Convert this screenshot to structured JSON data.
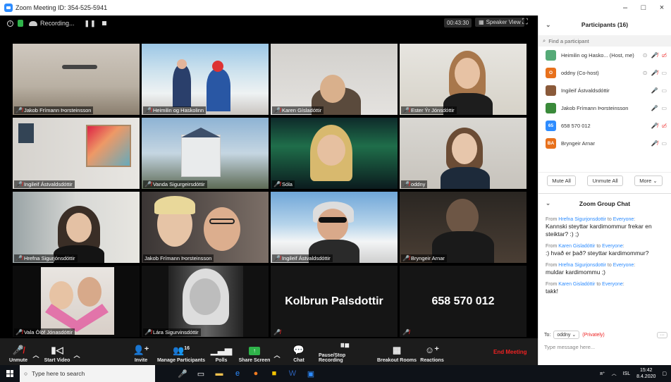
{
  "window": {
    "title": "Zoom Meeting ID: 354-525-5941",
    "minimize": "–",
    "maximize": "□",
    "close": "×"
  },
  "topbar": {
    "recording": "Recording...",
    "timer": "00:43:30",
    "view": "Speaker View"
  },
  "tiles": [
    {
      "name": "Jakob Frímann Þorsteinsson",
      "muted": true
    },
    {
      "name": "Heimilin og Haskolinn",
      "muted": true
    },
    {
      "name": "Karen Gísladóttir",
      "muted": true
    },
    {
      "name": "Ester Ýr Jónsdóttir",
      "muted": true
    },
    {
      "name": "Ingileif Ástvaldsdóttir",
      "muted": true
    },
    {
      "name": "Vanda Sigurgeirsdóttir",
      "muted": true
    },
    {
      "name": "Sóla",
      "muted": true
    },
    {
      "name": "oddny",
      "muted": true
    },
    {
      "name": "Hrefna Sigurjónsdóttir",
      "muted": true
    },
    {
      "name": "Jakob Frímann Þorsteinsson",
      "muted": false
    },
    {
      "name": "Ingileif Ástvaldsdóttir",
      "muted": true
    },
    {
      "name": "Bryngeir Arnar",
      "muted": true
    },
    {
      "name": "Vala Ólöf Jónasdóttir",
      "muted": true
    },
    {
      "name": "Lára Sigurvinsdóttir",
      "muted": true
    },
    {
      "name": "Kolbrun Palsdottir",
      "muted": true
    },
    {
      "name": "658 570 012",
      "muted": true
    }
  ],
  "toolbar": {
    "unmute": "Unmute",
    "start_video": "Start Video",
    "invite": "Invite",
    "manage_participants": "Manage Participants",
    "participant_count": "16",
    "polls": "Polls",
    "share_screen": "Share Screen",
    "chat": "Chat",
    "pause_recording": "Pause/Stop Recording",
    "breakout_rooms": "Breakout Rooms",
    "reactions": "Reactions",
    "end_meeting": "End Meeting"
  },
  "participants": {
    "title": "Participants (16)",
    "search_placeholder": "Find a participant",
    "list": [
      {
        "name": "Heimilin og Hasko... (Host, me)",
        "avatar": "",
        "color": "#5a7"
      },
      {
        "name": "oddny (Co-host)",
        "avatar": "O",
        "color": "#e8711c"
      },
      {
        "name": "Ingileif Ástvaldsdóttir",
        "avatar": "",
        "color": "#8a5a3a"
      },
      {
        "name": "Jakob Frímann Þorsteinsson",
        "avatar": "",
        "color": "#3a8a3a"
      },
      {
        "name": "658 570 012",
        "avatar": "65",
        "color": "#2d8cff"
      },
      {
        "name": "Bryngeir Arnar",
        "avatar": "BA",
        "color": "#e8711c"
      }
    ],
    "mute_all": "Mute All",
    "unmute_all": "Unmute All",
    "more": "More ⌄"
  },
  "chat": {
    "title": "Zoom Group Chat",
    "messages": [
      {
        "from": "Hrefna Sigurjonsdottir",
        "to": "Everyone",
        "text": "Kannski steyttar kardimommur frekar en steiktar? :) ;)"
      },
      {
        "from": "Karen Gisladóttir",
        "to": "Everyone",
        "text": ":) hvað er það? steyttar kardimommur?"
      },
      {
        "from": "Hrefna Sigurjonsdottir",
        "to": "Everyone",
        "text": "muldar kardimommu ;)"
      },
      {
        "from": "Karen Gisladóttir",
        "to": "Everyone",
        "text": "takk!"
      }
    ],
    "to_label": "To:",
    "recipient": "oddny ⌄",
    "privately": "(Privately)",
    "input_placeholder": "Type message here..."
  },
  "taskbar": {
    "search_placeholder": "Type here to search",
    "lang": "ISL",
    "time": "15:42",
    "date": "8.4.2020"
  },
  "colors": {
    "accent": "#2d8cff",
    "danger": "#e22222",
    "active_tile": "#d8e23a"
  }
}
